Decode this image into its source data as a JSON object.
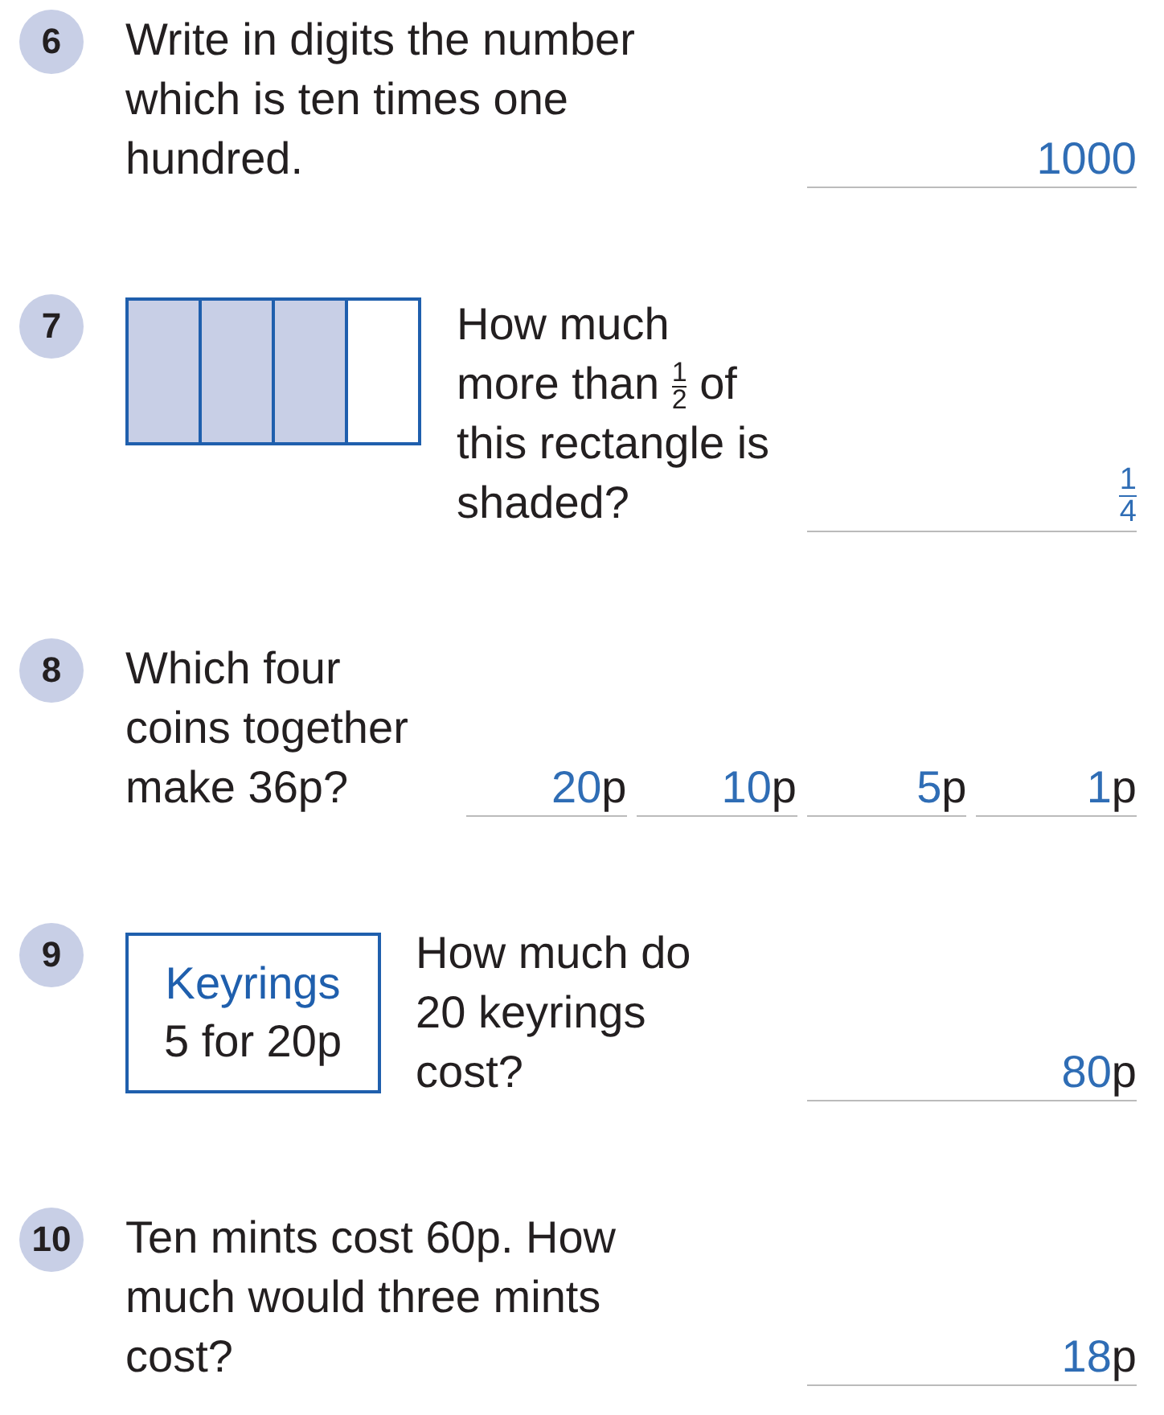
{
  "questions": [
    {
      "number": "6",
      "text": "Write in digits the number which is ten times one hundred.",
      "answers": [
        {
          "kind": "number",
          "value": "1000"
        }
      ]
    },
    {
      "number": "7",
      "figure": {
        "kind": "bar",
        "cells": [
          {
            "shaded": true
          },
          {
            "shaded": true
          },
          {
            "shaded": true
          },
          {
            "shaded": false
          }
        ]
      },
      "text": "How much more than",
      "fraction": {
        "numerator": "1",
        "denominator": "2"
      },
      "text_after": "of this rectangle is shaded?",
      "answers": [
        {
          "kind": "fraction",
          "numerator": "1",
          "denominator": "4"
        }
      ]
    },
    {
      "number": "8",
      "text": "Which four coins together make 36p?",
      "answers": [
        {
          "kind": "number",
          "value": "20",
          "unit": "p"
        },
        {
          "kind": "number",
          "value": "10",
          "unit": "p"
        },
        {
          "kind": "number",
          "value": "5",
          "unit": "p"
        },
        {
          "kind": "number",
          "value": "1",
          "unit": "p"
        }
      ]
    },
    {
      "number": "9",
      "figure": {
        "kind": "sign",
        "title": "Keyrings",
        "text": "5 for 20p"
      },
      "text": "How much do 20 keyrings cost?",
      "answers": [
        {
          "kind": "number",
          "value": "80",
          "unit": "p"
        }
      ]
    },
    {
      "number": "10",
      "text": "Ten mints cost 60p. How much would three mints cost?",
      "answers": [
        {
          "kind": "number",
          "value": "18",
          "unit": "p"
        }
      ]
    }
  ]
}
